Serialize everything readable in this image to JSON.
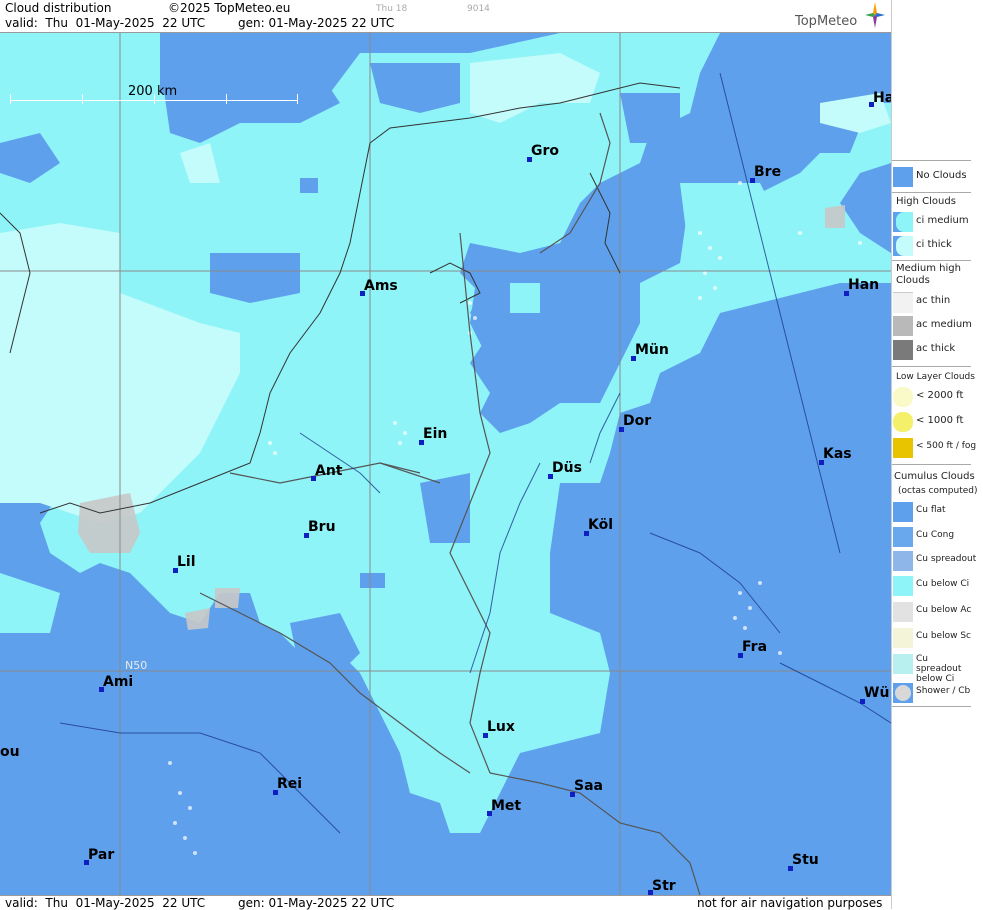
{
  "header": {
    "title": "Cloud distribution",
    "copyright": "©2025 TopMeteo.eu",
    "run_small": "Thu 18",
    "code_small": "9014",
    "valid": "valid:  Thu  01-May-2025  22 UTC",
    "gen": "gen: 01-May-2025 22 UTC",
    "logo": "TopMeteo"
  },
  "footer": {
    "valid": "valid:  Thu  01-May-2025  22 UTC",
    "gen": "gen: 01-May-2025 22 UTC",
    "notice": "not for air navigation purposes"
  },
  "map": {
    "scale_label": "200 km",
    "lat_label": "N50",
    "cities": [
      {
        "name": "Ha"
      },
      {
        "name": "Gro"
      },
      {
        "name": "Bre"
      },
      {
        "name": "Ams"
      },
      {
        "name": "Han"
      },
      {
        "name": "Mün"
      },
      {
        "name": "Dor"
      },
      {
        "name": "Ein"
      },
      {
        "name": "Kas"
      },
      {
        "name": "Ant"
      },
      {
        "name": "Düs"
      },
      {
        "name": "Bru"
      },
      {
        "name": "Köl"
      },
      {
        "name": "Lil"
      },
      {
        "name": "Fra"
      },
      {
        "name": "Ami"
      },
      {
        "name": "Wü"
      },
      {
        "name": "Lux"
      },
      {
        "name": "ou"
      },
      {
        "name": "Rei"
      },
      {
        "name": "Saa"
      },
      {
        "name": "Met"
      },
      {
        "name": "Par"
      },
      {
        "name": "Stu"
      },
      {
        "name": "Str"
      }
    ],
    "colors": {
      "no_clouds": "#5fa0ec",
      "ci_medium": "#8ef4f8",
      "ci_thick": "#b8fbfb",
      "ac": "#c8c8c8"
    }
  },
  "legend": {
    "no_clouds": "No Clouds",
    "high_header": "High Clouds",
    "ci_medium": "ci medium",
    "ci_thick": "ci thick",
    "medium_header": "Medium high Clouds",
    "ac_thin": "ac thin",
    "ac_medium": "ac medium",
    "ac_thick": "ac thick",
    "low_header": "Low Layer Clouds",
    "low_2000": "< 2000 ft",
    "low_1000": "< 1000 ft",
    "low_500": "< 500 ft / fog",
    "cumulus_header": "Cumulus Clouds",
    "cumulus_sub": "(octas computed)",
    "cu_flat": "Cu flat",
    "cu_cong": "Cu Cong",
    "cu_spreadout": "Cu spreadout",
    "cu_below_ci": "Cu below Ci",
    "cu_below_ac": "Cu below Ac",
    "cu_below_sc": "Cu below Sc",
    "cu_spreadout_below_ci": "Cu spreadout below Ci",
    "shower": "Shower / Cb"
  }
}
